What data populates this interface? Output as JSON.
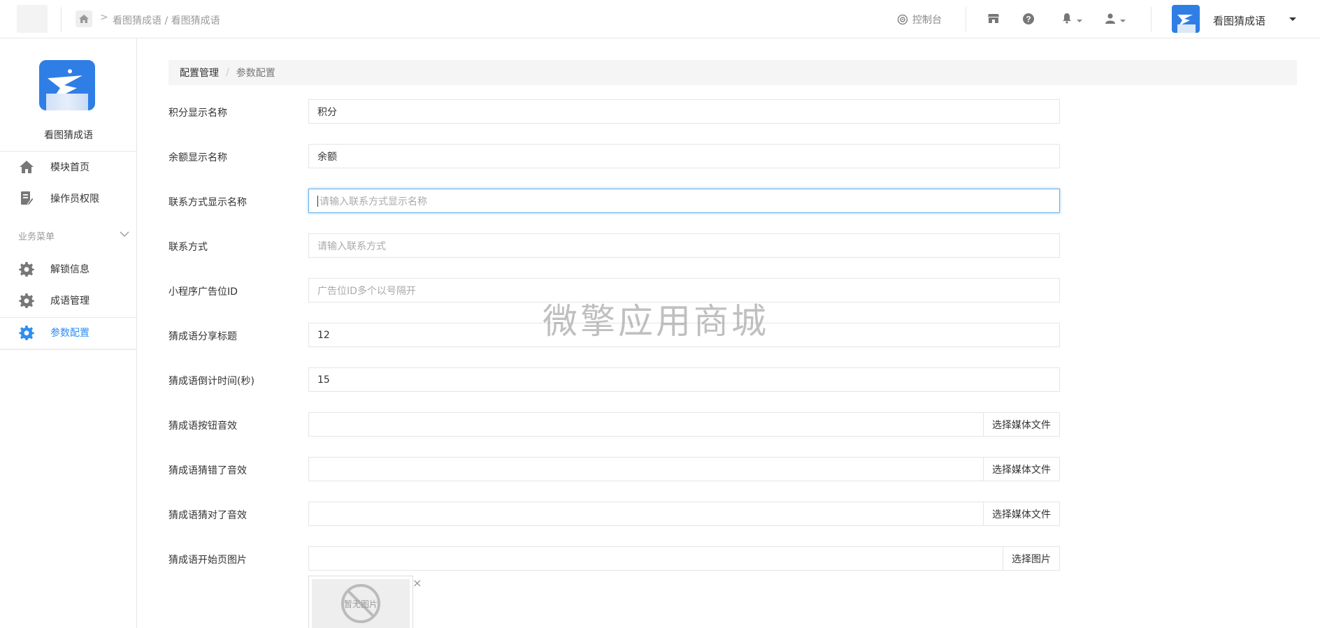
{
  "topbar": {
    "breadcrumb": "看图猜成语 / 看图猜成语",
    "console_label": "控制台",
    "user_name": "看图猜成语"
  },
  "sidebar": {
    "app_name": "看图猜成语",
    "section_title": "业务菜单",
    "items": [
      {
        "label": "模块首页",
        "icon": "home-icon"
      },
      {
        "label": "操作员权限",
        "icon": "edit-doc-icon"
      },
      {
        "label": "解锁信息",
        "icon": "gear-icon"
      },
      {
        "label": "成语管理",
        "icon": "gear-icon"
      },
      {
        "label": "参数配置",
        "icon": "gear-icon",
        "active": true
      }
    ],
    "active_color": "#2f8ef0"
  },
  "page": {
    "breadcrumb_parent": "配置管理",
    "breadcrumb_current": "参数配置"
  },
  "form": {
    "fields": [
      {
        "label": "积分显示名称",
        "value": "积分",
        "placeholder": ""
      },
      {
        "label": "余额显示名称",
        "value": "余额",
        "placeholder": ""
      },
      {
        "label": "联系方式显示名称",
        "value": "",
        "placeholder": "请输入联系方式显示名称"
      },
      {
        "label": "联系方式",
        "value": "",
        "placeholder": "请输入联系方式"
      },
      {
        "label": "小程序广告位ID",
        "value": "",
        "placeholder": "广告位ID多个以号隔开"
      },
      {
        "label": "猜成语分享标题",
        "value": "12",
        "placeholder": ""
      },
      {
        "label": "猜成语倒计时间(秒)",
        "value": "15",
        "placeholder": ""
      },
      {
        "label": "猜成语按钮音效",
        "value": "",
        "button": "选择媒体文件"
      },
      {
        "label": "猜成语猜错了音效",
        "value": "",
        "button": "选择媒体文件"
      },
      {
        "label": "猜成语猜对了音效",
        "value": "",
        "button": "选择媒体文件"
      },
      {
        "label": "猜成语开始页图片",
        "value": "",
        "button": "选择图片"
      }
    ],
    "no_image_text": "暂无图片",
    "close_glyph": "×"
  },
  "watermark": "微擎应用商城"
}
